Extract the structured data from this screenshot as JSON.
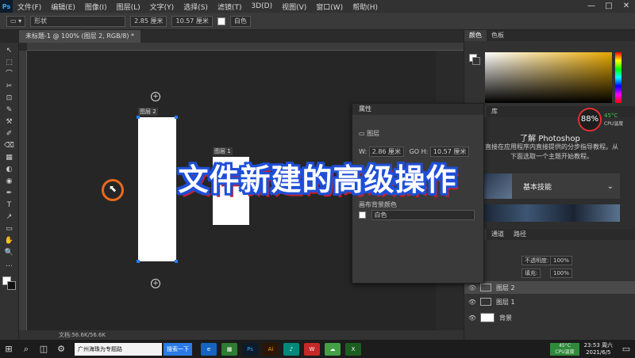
{
  "app": {
    "logo": "Ps"
  },
  "menubar": {
    "items": [
      "文件(F)",
      "编辑(E)",
      "图像(I)",
      "图层(L)",
      "文字(Y)",
      "选择(S)",
      "滤镜(T)",
      "3D(D)",
      "视图(V)",
      "窗口(W)",
      "帮助(H)"
    ],
    "window_controls": [
      "—",
      "□",
      "✕"
    ]
  },
  "options": {
    "mode": "形状",
    "width": "2.85 厘米",
    "height": "10.57 厘米",
    "fill_label": "白色"
  },
  "document": {
    "tab_label": "未标题-1 @ 100% (图层 2, RGB/8) *",
    "status": "文档:56.6K/56.6K"
  },
  "tools": [
    "↖",
    "⬚",
    "⌒",
    "✂",
    "⊡",
    "✎",
    "⚒",
    "✐",
    "⌫",
    "▦",
    "◐",
    "◉",
    "✒",
    "T",
    "↗",
    "▭",
    "✋",
    "🔍",
    "…"
  ],
  "canvas": {
    "layer2_label": "图层 2",
    "layer1_label": "图层 1",
    "plus": "+",
    "cursor_glyph": "⬉"
  },
  "overlay": {
    "caption": "文件新建的高级操作"
  },
  "color_panel": {
    "tabs": [
      "颜色",
      "色板"
    ]
  },
  "learn_panel": {
    "tabs": [
      "学习",
      "库"
    ],
    "title": "了解 Photoshop",
    "desc_line1": "直接在应用程序内直接提供的分步指导教程。从",
    "desc_line2": "下面选取一个主题开始教程。",
    "basic_label": "基本技能",
    "chevron": "⌄"
  },
  "cpu_overlay": {
    "value": "88%",
    "temp": "45°C",
    "label": "CPU温度"
  },
  "layers_panel": {
    "tabs": [
      "图层",
      "通道",
      "路径"
    ],
    "opacity_label": "不透明度:",
    "opacity_value": "100%",
    "fill_label": "填充:",
    "fill_value": "100%",
    "layers": [
      {
        "name": "图层 2",
        "selected": true,
        "thumb": "white"
      },
      {
        "name": "图层 1",
        "selected": false,
        "thumb": "white"
      },
      {
        "name": "背景",
        "selected": false,
        "thumb": "white"
      }
    ],
    "eye": "👁"
  },
  "properties_panel": {
    "title": "属性",
    "type_label": "图层",
    "width_label": "W:",
    "width_value": "2.86 厘米",
    "height_label": "H:",
    "height_value": "10.57 厘米",
    "go_label": "GO",
    "bg_label": "画布背景颜色",
    "bg_value": "白色"
  },
  "taskbar": {
    "start": "⊞",
    "search_text": "广州海珠为专题路",
    "search_btn": "搜索一下",
    "apps": [
      "e",
      "▦",
      "Ps",
      "Ai",
      "♪",
      "W",
      "☁",
      "X"
    ],
    "cpu_temp": "45°C",
    "cpu_label": "CPU温度",
    "time": "23:53 周六",
    "date": "2021/6/5",
    "notify": "▭",
    "cpu_color": "#2f8a3a"
  }
}
